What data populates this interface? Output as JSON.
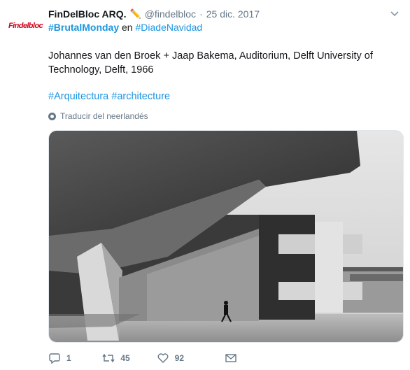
{
  "tweet": {
    "avatar_text": "Findelbloc",
    "author_name": "FinDelBloc ARQ.",
    "author_emoji": "✏️",
    "handle": "@findelbloc",
    "separator": "·",
    "date": "25 dic. 2017",
    "tag_primary": "#BrutalMonday",
    "connector": "en",
    "tag_secondary": "#DiadeNavidad",
    "body": "Johannes van den Broek + Jaap Bakema, Auditorium, Delft University of Technology, Delft, 1966",
    "hashtag_1": "#Arquitectura",
    "hashtag_2": "#architecture",
    "translate_label": "Traducir del neerlandés"
  },
  "actions": {
    "reply_count": "1",
    "retweet_count": "45",
    "like_count": "92"
  },
  "icons": {
    "menu": "chevron-down-icon",
    "translate": "globe-icon",
    "reply": "reply-icon",
    "retweet": "retweet-icon",
    "like": "heart-icon",
    "dm": "mail-icon"
  },
  "colors": {
    "link": "#1b95e0",
    "muted": "#657786",
    "avatar_brand": "#d0021b"
  }
}
